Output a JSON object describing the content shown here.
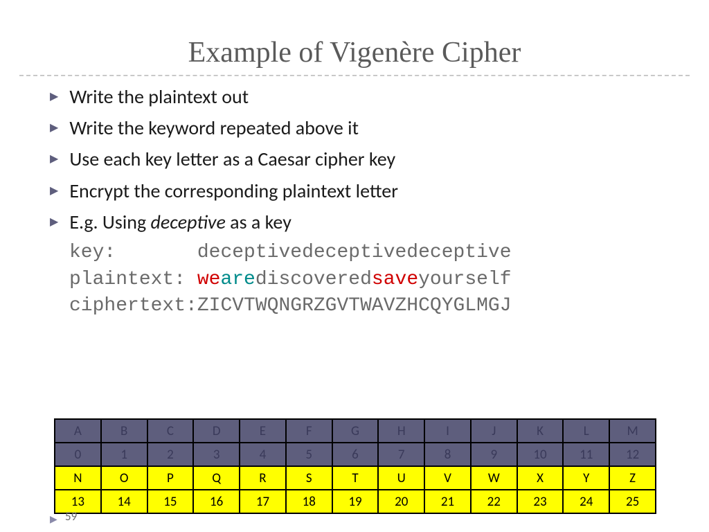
{
  "title": "Example of Vigenère Cipher",
  "bullets": [
    "Write the plaintext out",
    "Write the keyword repeated above it",
    "Use each key letter as a Caesar cipher key",
    "Encrypt the corresponding plaintext letter"
  ],
  "bullet5_pre": "E.g. Using ",
  "bullet5_ital": "deceptive",
  "bullet5_post": " as a key",
  "mono": {
    "key_label": "key:       ",
    "key_value": "deceptivedeceptivedeceptive",
    "plain_label": "plaintext: ",
    "plain_seg1": "we",
    "plain_seg2": "are",
    "plain_seg3": "discovered",
    "plain_seg4": "save",
    "plain_seg5": "yourself",
    "cipher_label": "ciphertext:",
    "cipher_value": "ZICVTWQNGRZGVTWAVZHCQYGLMGJ"
  },
  "table": {
    "letters1": [
      "A",
      "B",
      "C",
      "D",
      "E",
      "F",
      "G",
      "H",
      "I",
      "J",
      "K",
      "L",
      "M"
    ],
    "numbers1": [
      "0",
      "1",
      "2",
      "3",
      "4",
      "5",
      "6",
      "7",
      "8",
      "9",
      "10",
      "11",
      "12"
    ],
    "letters2": [
      "N",
      "O",
      "P",
      "Q",
      "R",
      "S",
      "T",
      "U",
      "V",
      "W",
      "X",
      "Y",
      "Z"
    ],
    "numbers2": [
      "13",
      "14",
      "15",
      "16",
      "17",
      "18",
      "19",
      "20",
      "21",
      "22",
      "23",
      "24",
      "25"
    ]
  },
  "page_number": "59"
}
